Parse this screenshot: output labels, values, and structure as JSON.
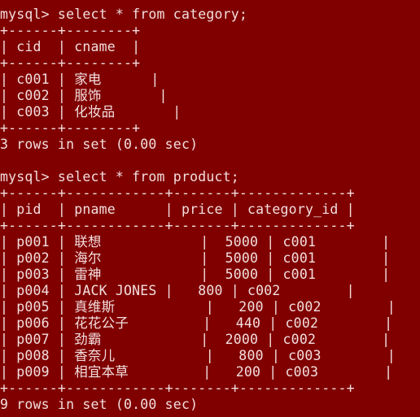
{
  "terminal": {
    "lines": [
      "mysql> select * from category;",
      "+------+--------+",
      "| cid  | cname  |",
      "+------+--------+",
      "| c001 | 家电      |",
      "| c002 | 服饰       |",
      "| c003 | 化妆品       |",
      "+------+--------+",
      "3 rows in set (0.00 sec)",
      "",
      "mysql> select * from product;",
      "+------+------------+-------+-------------+",
      "| pid  | pname      | price | category_id |",
      "+------+------------+-------+-------------+",
      "| p001 | 联想            |  5000 | c001        |",
      "| p002 | 海尔            |  5000 | c001        |",
      "| p003 | 雷神            |  5000 | c001        |",
      "| p004 | JACK JONES |   800 | c002        |",
      "| p005 | 真维斯           |   200 | c002        |",
      "| p006 | 花花公子         |   440 | c002        |",
      "| p007 | 劲霸            |  2000 | c002        |",
      "| p008 | 香奈儿           |   800 | c003        |",
      "| p009 | 相宜本草         |   200 | c003        |",
      "+------+------------+-------+-------------+",
      "9 rows in set (0.00 sec)"
    ]
  }
}
